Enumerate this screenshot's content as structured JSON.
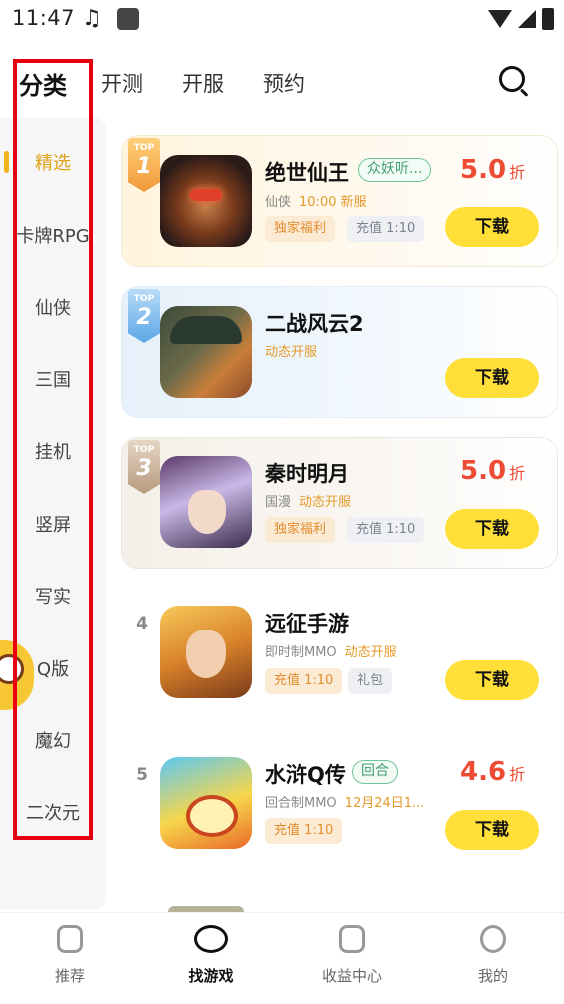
{
  "status": {
    "time": "11:47",
    "music_icon": "music-note-icon"
  },
  "top_tabs": [
    {
      "label": "分类"
    },
    {
      "label": "开测"
    },
    {
      "label": "开服"
    },
    {
      "label": "预约"
    }
  ],
  "categories": [
    "精选",
    "卡牌RPG",
    "仙侠",
    "三国",
    "挂机",
    "竖屏",
    "写实",
    "Q版",
    "魔幻",
    "二次元"
  ],
  "games": [
    {
      "rank_top": "TOP",
      "rank": "1",
      "name": "绝世仙王",
      "tag": "众妖听...",
      "meta": "仙侠",
      "meta_hl": "10:00 新服",
      "chips": [
        "独家福利",
        "充值 1:10"
      ],
      "discount": "5.0",
      "unit": "折",
      "download": "下载"
    },
    {
      "rank_top": "TOP",
      "rank": "2",
      "name": "二战风云2",
      "meta": "",
      "meta_hl": "动态开服",
      "download": "下载"
    },
    {
      "rank_top": "TOP",
      "rank": "3",
      "name": "秦时明月",
      "meta": "国漫",
      "meta_hl": "动态开服",
      "chips": [
        "独家福利",
        "充值 1:10"
      ],
      "discount": "5.0",
      "unit": "折",
      "download": "下载"
    },
    {
      "rank": "4",
      "name": "远征手游",
      "meta": "即时制MMO",
      "meta_hl": "动态开服",
      "chips": [
        "充值 1:10",
        "礼包"
      ],
      "download": "下载"
    },
    {
      "rank": "5",
      "name": "水浒Q传",
      "tag": "回合",
      "meta": "回合制MMO",
      "meta_hl": "12月24日1...",
      "chips": [
        "充值 1:10"
      ],
      "discount": "4.6",
      "unit": "折",
      "download": "下载"
    }
  ],
  "bottom_nav": [
    {
      "label": "推荐"
    },
    {
      "label": "找游戏"
    },
    {
      "label": "收益中心"
    },
    {
      "label": "我的"
    }
  ],
  "colors": {
    "accent_yellow": "#ffdf38",
    "discount_red": "#ee4b35",
    "highlight_box": "#e60012",
    "active_category": "#e0a21a"
  }
}
